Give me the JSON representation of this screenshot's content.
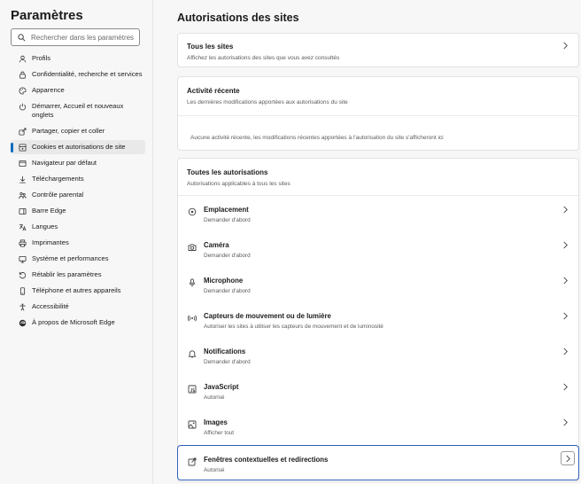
{
  "sidebar": {
    "title": "Paramètres",
    "search_placeholder": "Rechercher dans les paramètres",
    "items": [
      {
        "label": "Profils",
        "icon": "profile-icon"
      },
      {
        "label": "Confidentialité, recherche et services",
        "icon": "lock-icon"
      },
      {
        "label": "Apparence",
        "icon": "palette-icon"
      },
      {
        "label": "Démarrer, Accueil et nouveaux onglets",
        "icon": "power-icon"
      },
      {
        "label": "Partager, copier et coller",
        "icon": "share-icon"
      },
      {
        "label": "Cookies et autorisations de site",
        "icon": "cookie-icon",
        "active": true
      },
      {
        "label": "Navigateur par défaut",
        "icon": "browser-icon"
      },
      {
        "label": "Téléchargements",
        "icon": "download-icon"
      },
      {
        "label": "Contrôle parental",
        "icon": "family-icon"
      },
      {
        "label": "Barre Edge",
        "icon": "sidebar-icon"
      },
      {
        "label": "Langues",
        "icon": "language-icon"
      },
      {
        "label": "Imprimantes",
        "icon": "printer-icon"
      },
      {
        "label": "Système et performances",
        "icon": "system-icon"
      },
      {
        "label": "Rétablir les paramètres",
        "icon": "reset-icon"
      },
      {
        "label": "Téléphone et autres appareils",
        "icon": "phone-icon"
      },
      {
        "label": "Accessibilité",
        "icon": "accessibility-icon"
      },
      {
        "label": "À propos de Microsoft Edge",
        "icon": "edge-icon"
      }
    ]
  },
  "main": {
    "title": "Autorisations des sites",
    "all_sites": {
      "title": "Tous les sites",
      "subtitle": "Affichez les autorisations des sites que vous avez consultés"
    },
    "recent": {
      "title": "Activité récente",
      "subtitle": "Les dernières modifications apportées aux autorisations du site",
      "empty": "Aucune activité récente, les modifications récentes apportées à l'autorisation du site s'afficheront ici"
    },
    "all_permissions": {
      "title": "Toutes les autorisations",
      "subtitle": "Autorisations applicables à tous les sites",
      "rows": [
        {
          "title": "Emplacement",
          "subtitle": "Demander d'abord",
          "icon": "location-icon"
        },
        {
          "title": "Caméra",
          "subtitle": "Demander d'abord",
          "icon": "camera-icon"
        },
        {
          "title": "Microphone",
          "subtitle": "Demander d'abord",
          "icon": "microphone-icon"
        },
        {
          "title": "Capteurs de mouvement ou de lumière",
          "subtitle": "Autoriser les sites à utiliser les capteurs de mouvement et de luminosité",
          "icon": "sensor-icon"
        },
        {
          "title": "Notifications",
          "subtitle": "Demander d'abord",
          "icon": "bell-icon"
        },
        {
          "title": "JavaScript",
          "subtitle": "Autorisé",
          "icon": "javascript-icon"
        },
        {
          "title": "Images",
          "subtitle": "Afficher tout",
          "icon": "image-icon"
        },
        {
          "title": "Fenêtres contextuelles et redirections",
          "subtitle": "Autorisé",
          "icon": "popup-icon",
          "focused": true
        }
      ]
    }
  },
  "colors": {
    "accent": "#0f6cbd",
    "focus": "#2f5fb8",
    "card": "#ffffff",
    "background": "#f7f7f7"
  }
}
